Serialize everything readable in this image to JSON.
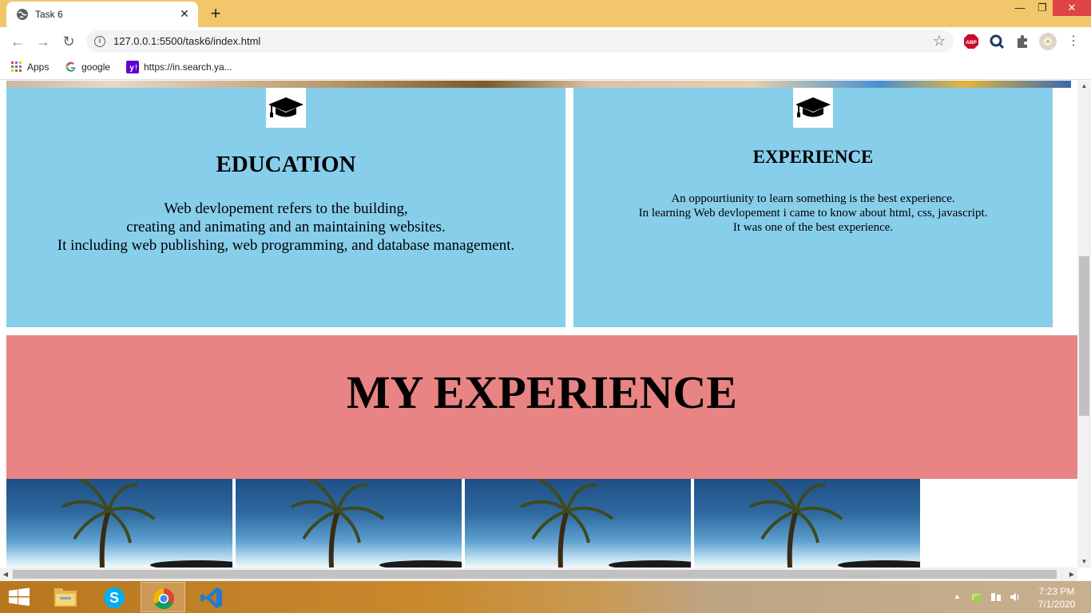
{
  "browser": {
    "tab_title": "Task 6",
    "tab_close": "✕",
    "new_tab": "+",
    "url": "127.0.0.1:5500/task6/index.html",
    "bookmarks": [
      {
        "label": "Apps",
        "icon": "apps-grid-icon"
      },
      {
        "label": "google",
        "icon": "google-icon"
      },
      {
        "label": "https://in.search.ya...",
        "icon": "yahoo-icon"
      }
    ]
  },
  "page": {
    "education": {
      "icon": "graduation-cap-icon",
      "title": "EDUCATION",
      "lines": [
        "Web devlopement refers to the building,",
        "creating and animating and an maintaining websites.",
        "It including web publishing, web programming, and database management."
      ]
    },
    "experience": {
      "icon": "graduation-cap-icon",
      "title": "EXPERIENCE",
      "lines": [
        "An oppourtiunity to learn something is the best experience.",
        "In learning Web devlopement i came to know about html, css, javascript.",
        "It was one of the best experience."
      ]
    },
    "banner_title": "MY EXPERIENCE",
    "colors": {
      "card_bg": "#87ceeb",
      "banner_bg": "#e88484"
    }
  },
  "taskbar": {
    "apps": [
      "file-explorer",
      "skype",
      "chrome",
      "vscode"
    ],
    "time": "7:23 PM",
    "date": "7/1/2020"
  }
}
